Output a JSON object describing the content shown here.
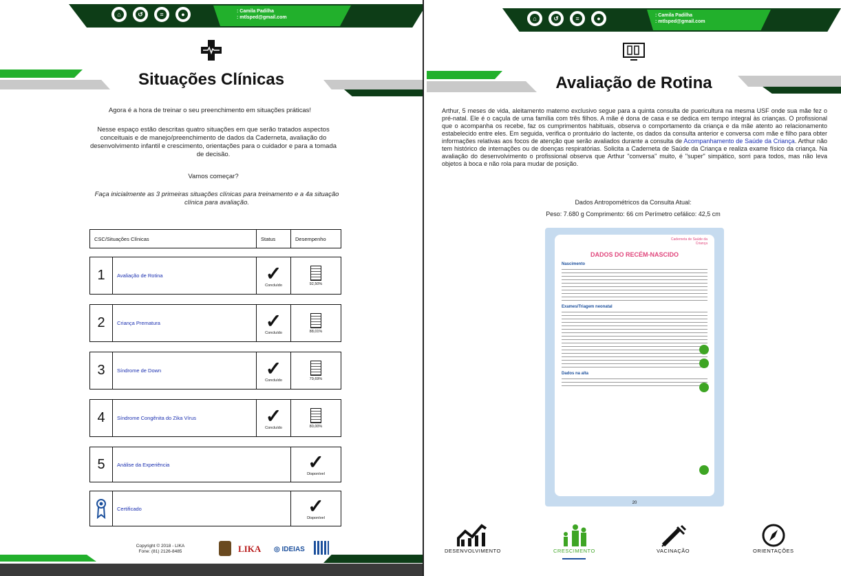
{
  "user": {
    "name": "Camila Padilha",
    "email": "mtlsped@gmail.com"
  },
  "left": {
    "title": "Situações Clínicas",
    "intro": "Agora é a hora de treinar o seu preenchimento em situações práticas!",
    "desc": "Nesse espaço estão descritas quatro situações em que serão tratados aspectos conceituais e de manejo/preenchimento de dados da Caderneta, avaliação do desenvolvimento infantil e crescimento, orientações para o cuidador e para a tomada de decisão.",
    "start": "Vamos começar?",
    "instruction": "Faça inicialmente as 3 primeiras situações clínicas para treinamento e a 4a situação clínica para avaliação.",
    "table_headers": [
      "CSC/Situações Clínicas",
      "Status",
      "Desempenho"
    ],
    "rows": [
      {
        "num": "1",
        "name": "Avaliação de Rotina",
        "status": "Concluído",
        "score": "92,50%"
      },
      {
        "num": "2",
        "name": "Criança Prematura",
        "status": "Concluído",
        "score": "88,01%"
      },
      {
        "num": "3",
        "name": "Síndrome de Down",
        "status": "Concluído",
        "score": "79,69%"
      },
      {
        "num": "4",
        "name": "Síndrome Congênita do Zika Vírus",
        "status": "Concluído",
        "score": "80,00%"
      },
      {
        "num": "5",
        "name": "Análise da Experiência",
        "status": "Disponível"
      },
      {
        "num": "",
        "name": "Certificado",
        "status": "Disponível"
      }
    ],
    "copyright": "Copyright © 2018 - LIKA",
    "phone": "Fone: (81) 2126-8485",
    "logos": [
      "LIKA",
      "IDEIAS"
    ]
  },
  "right": {
    "title": "Avaliação de Rotina",
    "story_a": "Arthur, 5 meses de vida, aleitamento materno exclusivo segue para a quinta consulta de puericultura na mesma USF onde sua mãe fez o pré-natal. Ele é o caçula de uma família com três filhos. A mãe é dona de casa e se dedica em tempo integral às crianças. O profissional que o acompanha os recebe, faz os cumprimentos habituais, observa o comportamento da criança e da mãe atento ao relacionamento estabelecido entre eles. Em seguida, verifica o prontuário do lactente, os dados da consulta anterior e conversa com mãe e filho para obter informações relativas aos focos de atenção que serão avaliados durante a consulta de",
    "story_link": "Acompanhamento de Saúde da Criança",
    "story_b": ". Arthur não tem histórico de internações ou de doenças respiratórias. Solicita a Caderneta de Saúde da Criança e realiza exame físico da criança. Na avaliação do desenvolvimento o profissional observa que Arthur \"conversa\" muito, é \"super\" simpático, sorri para todos, mas não leva objetos à boca e não rola para mudar de posição.",
    "data_title": "Dados Antropométricos da Consulta Atual:",
    "data_values": "Peso: 7.680 g Comprimento: 66 cm Perímetro cefálico: 42,5 cm",
    "form": {
      "header_small": "Caderneta de Saúde da Criança",
      "title": "DADOS DO RECÉM-NASCIDO",
      "section1": "Nascimento",
      "section2": "Exames/Triagem neonatal",
      "section3": "Dados na alta",
      "page": "20"
    },
    "nav": [
      "DESENVOLVIMENTO",
      "CRESCIMENTO",
      "VACINAÇÃO",
      "ORIENTAÇÕES"
    ]
  }
}
